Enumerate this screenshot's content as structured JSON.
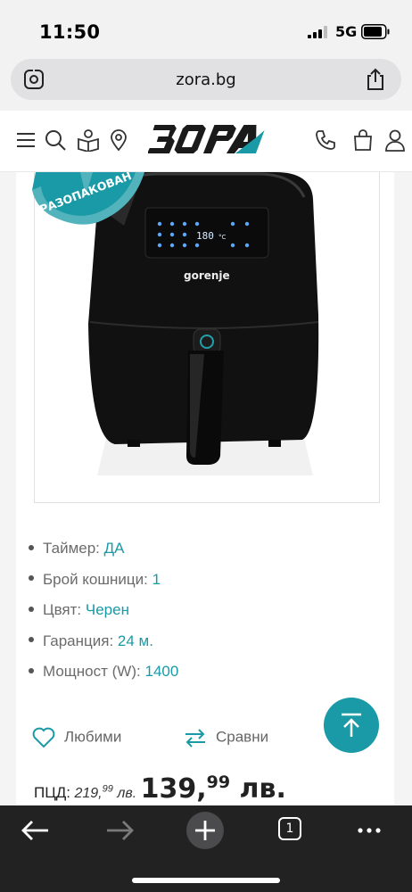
{
  "status_bar": {
    "time": "11:50",
    "network": "5G"
  },
  "browser": {
    "url": "zora.bg",
    "tab_count": "1"
  },
  "header": {
    "logo_text": "ЗОРА"
  },
  "product": {
    "badge": "РАЗОПАКОВАН",
    "brand_on_device": "gorenje",
    "display_reading": "180"
  },
  "features": [
    {
      "label": "Таймер:",
      "value": "ДА"
    },
    {
      "label": "Брой кошници:",
      "value": "1"
    },
    {
      "label": "Цвят:",
      "value": "Черен"
    },
    {
      "label": "Гаранция:",
      "value": "24 м."
    },
    {
      "label": "Мощност (W):",
      "value": "1400"
    }
  ],
  "actions": {
    "favorites": "Любими",
    "compare": "Сравни"
  },
  "price": {
    "pcd_label": "ПЦД:",
    "old_main": "219,",
    "old_cents": "99",
    "old_currency": "лв.",
    "current_main": "139,",
    "current_cents": "99",
    "current_currency": "лв."
  },
  "colors": {
    "accent": "#1a9aa6",
    "toolbar": "#222223",
    "urlbar": "#e1e1e3"
  }
}
